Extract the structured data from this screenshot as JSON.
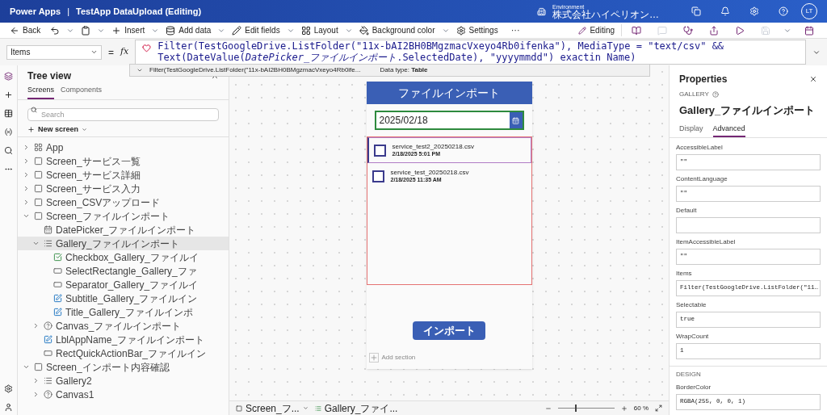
{
  "header": {
    "app_name": "Power Apps",
    "separator": "|",
    "title": "TestApp DataUpload (Editing)",
    "environment_label": "Environment",
    "environment_name": "株式会社ハイペリオン…",
    "avatar": "LT"
  },
  "toolbar": {
    "items": [
      {
        "kind": "back",
        "label": "Back"
      },
      {
        "kind": "undo"
      },
      {
        "kind": "paste"
      },
      {
        "kind": "insert",
        "label": "Insert"
      },
      {
        "kind": "data",
        "label": "Add data"
      },
      {
        "kind": "fields",
        "label": "Edit fields"
      },
      {
        "kind": "layout",
        "label": "Layout"
      },
      {
        "kind": "background",
        "label": "Background color"
      },
      {
        "kind": "settings",
        "label": "Settings"
      },
      {
        "kind": "more",
        "label": "···"
      }
    ],
    "mode": "Editing"
  },
  "formula_bar": {
    "property": "Items",
    "equals": "=",
    "fx": "fx",
    "formula": "Filter(TestGoogleDrive.ListFolder(\"11x-bAI2BH0BMgzmacVxeyo4Rb0ifenka\"), MediaType = \"text/csv\" && Text(DateValue(*DatePicker_ファイルインポート*.SelectedDate), \"yyyymmdd\") exactin Name)",
    "suggestion": "Filter(TestGoogleDrive.ListFolder(\"11x-bAI2BH0BMgzmacVxeyo4Rb0ife...",
    "data_type_label": "Data type:",
    "data_type": "Table"
  },
  "tree_view": {
    "title": "Tree view",
    "tabs": [
      {
        "label": "Screens",
        "selected": true
      },
      {
        "label": "Components",
        "selected": false
      }
    ],
    "search": {
      "placeholder": "Search"
    },
    "new_screen": "New screen",
    "items": [
      {
        "kind": "app",
        "label": "App",
        "expanded": false,
        "selected": false
      },
      {
        "kind": "screen",
        "label": "Screen_サービス一覧",
        "expanded": false,
        "selected": false
      },
      {
        "kind": "screen",
        "label": "Screen_サービス詳細",
        "expanded": false,
        "selected": false
      },
      {
        "kind": "screen",
        "label": "Screen_サービス入力",
        "expanded": false,
        "selected": false
      },
      {
        "kind": "screen",
        "label": "Screen_CSVアップロード",
        "expanded": false,
        "selected": false
      },
      {
        "kind": "screen",
        "label": "Screen_ファイルインポート",
        "expanded": true,
        "selected": false,
        "children": [
          {
            "kind": "datepicker",
            "label": "DatePicker_ファイルインポート",
            "selected": false
          },
          {
            "kind": "gallery",
            "label": "Gallery_ファイルインポート",
            "expanded": true,
            "selected": true,
            "children": [
              {
                "kind": "checkbox",
                "label": "Checkbox_Gallery_ファイルイ",
                "selected": false
              },
              {
                "kind": "rectangle",
                "label": "SelectRectangle_Gallery_ファ",
                "selected": false
              },
              {
                "kind": "rectangle",
                "label": "Separator_Gallery_ファイルイ",
                "selected": false
              },
              {
                "kind": "label",
                "label": "Subtitle_Gallery_ファイルイン",
                "selected": false
              },
              {
                "kind": "label",
                "label": "Title_Gallery_ファイルインポ",
                "selected": false
              }
            ]
          },
          {
            "kind": "canvas",
            "label": "Canvas_ファイルインポート",
            "expanded": false,
            "selected": false
          },
          {
            "kind": "label",
            "label": "LblAppName_ファイルインポート",
            "selected": false
          },
          {
            "kind": "rectangle",
            "label": "RectQuickActionBar_ファイルイン",
            "selected": false
          }
        ]
      },
      {
        "kind": "screen",
        "label": "Screen_インポート内容確認",
        "expanded": true,
        "selected": false,
        "children": [
          {
            "kind": "gallery",
            "label": "Gallery2",
            "expanded": false,
            "selected": false
          },
          {
            "kind": "canvas",
            "label": "Canvas1",
            "expanded": false,
            "selected": false
          }
        ]
      }
    ]
  },
  "app_screen": {
    "title": "ファイルインポート",
    "date": "2025/02/18",
    "gallery_items": [
      {
        "title": "service_test2_20250218.csv",
        "subtitle": "2/18/2025 5:01 PM",
        "checked": false,
        "selected": true
      },
      {
        "title": "service_test_20250218.csv",
        "subtitle": "2/18/2025 11:35 AM",
        "checked": false,
        "selected": false
      }
    ],
    "button": "インポート",
    "add_section": "Add section"
  },
  "status_bar": {
    "screen": "Screen_フ...",
    "control": "Gallery_ファイ...",
    "zoom": {
      "level": 0.3
    },
    "zoom_value": "60 %"
  },
  "properties": {
    "title": "Properties",
    "type": "GALLERY",
    "control_name": "Gallery_ファイルインポート",
    "tabs": [
      {
        "label": "Display",
        "selected": false
      },
      {
        "label": "Advanced",
        "selected": true
      }
    ],
    "fields": [
      {
        "label": "AccessibleLabel",
        "value": "\"\""
      },
      {
        "label": "ContentLanguage",
        "value": "\"\""
      },
      {
        "label": "Default"
      },
      {
        "label": "ItemAccessibleLabel",
        "value": "\"\""
      },
      {
        "label": "Items",
        "value": "Filter(TestGoogleDrive.ListFolder(\"11…"
      },
      {
        "label": "Selectable",
        "value": "true"
      },
      {
        "label": "WrapCount",
        "value": "1"
      }
    ],
    "section": "DESIGN",
    "design_fields": [
      {
        "label": "BorderColor",
        "value": "RGBA(255, 0, 0, 1)"
      }
    ]
  }
}
